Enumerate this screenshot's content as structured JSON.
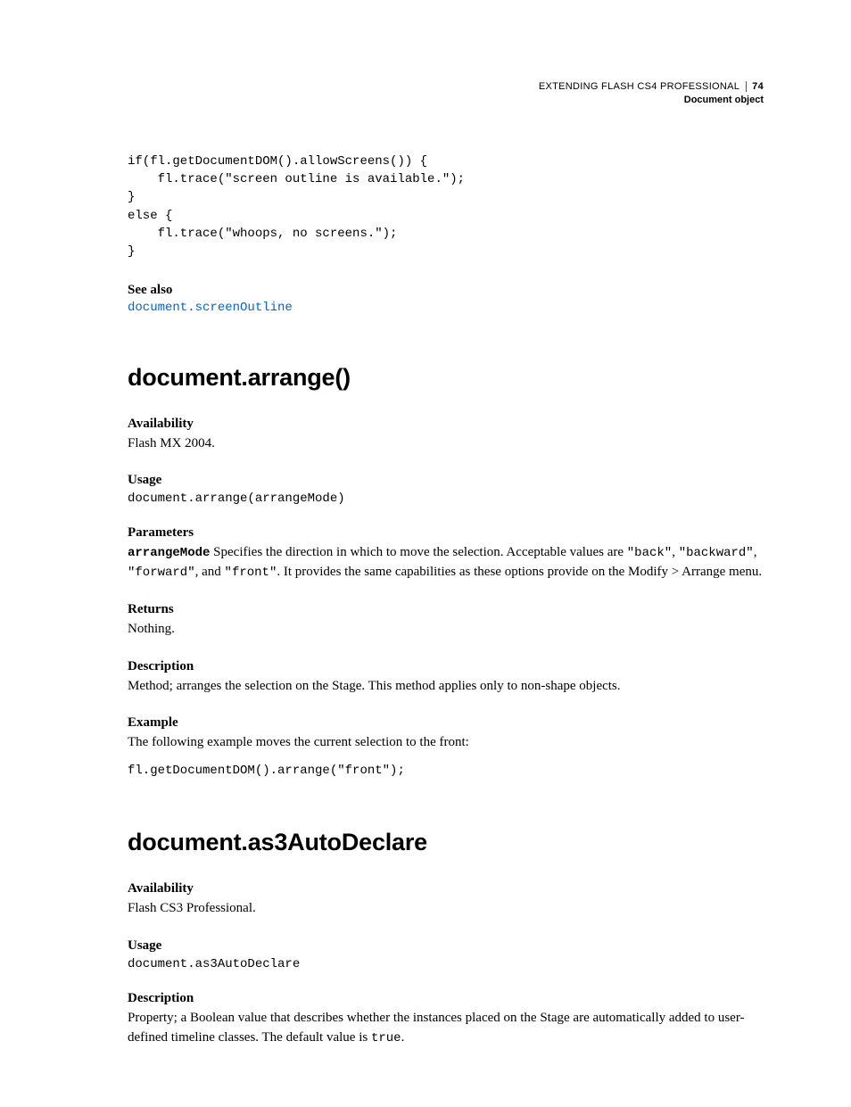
{
  "header": {
    "title": "EXTENDING FLASH CS4 PROFESSIONAL",
    "page_number": "74",
    "subtitle": "Document object"
  },
  "code_block_1": "if(fl.getDocumentDOM().allowScreens()) {\n    fl.trace(\"screen outline is available.\");\n}\nelse {\n    fl.trace(\"whoops, no screens.\");\n}",
  "see_also": {
    "heading": "See also",
    "link_text": "document.screenOutline"
  },
  "section1": {
    "title": "document.arrange()",
    "availability": {
      "heading": "Availability",
      "text": "Flash MX 2004."
    },
    "usage": {
      "heading": "Usage",
      "code": "document.arrange(arrangeMode)"
    },
    "parameters": {
      "heading": "Parameters",
      "param_name": "arrangeMode",
      "text_a": "  Specifies the direction in which to move the selection. Acceptable values are ",
      "val1": "\"back\"",
      "sep1": ", ",
      "val2": "\"backward\"",
      "sep2": ", ",
      "val3": "\"forward\"",
      "sep3": ", and ",
      "val4": "\"front\"",
      "text_b": ". It provides the same capabilities as these options provide on the Modify > Arrange menu."
    },
    "returns": {
      "heading": "Returns",
      "text": "Nothing."
    },
    "description": {
      "heading": "Description",
      "text": "Method; arranges the selection on the Stage. This method applies only to non-shape objects."
    },
    "example": {
      "heading": "Example",
      "text": "The following example moves the current selection to the front:",
      "code": "fl.getDocumentDOM().arrange(\"front\");"
    }
  },
  "section2": {
    "title": "document.as3AutoDeclare",
    "availability": {
      "heading": "Availability",
      "text": "Flash CS3 Professional."
    },
    "usage": {
      "heading": "Usage",
      "code": "document.as3AutoDeclare"
    },
    "description": {
      "heading": "Description",
      "text_a": "Property; a Boolean value that describes whether the instances placed on the Stage are automatically added to user-defined timeline classes. The default value is ",
      "default_val": "true",
      "text_b": "."
    }
  }
}
